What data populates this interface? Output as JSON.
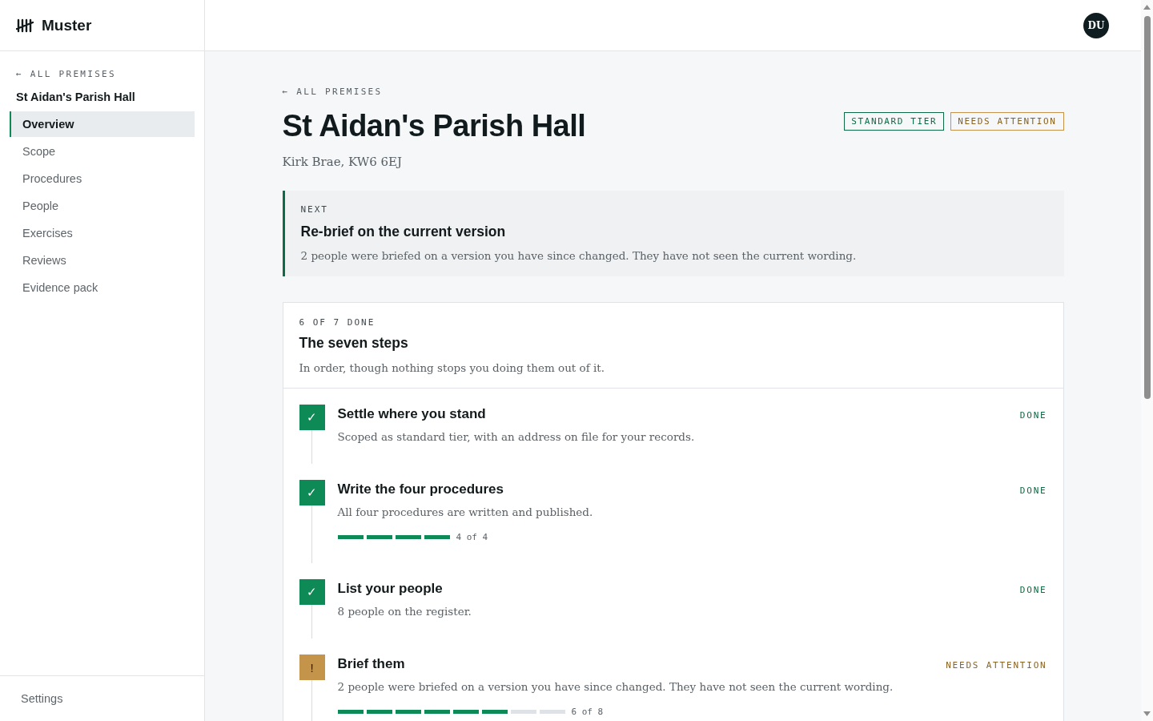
{
  "brand": {
    "name": "Muster"
  },
  "sidebar": {
    "back_link": "← ALL PREMISES",
    "premises": "St Aidan's Parish Hall",
    "items": [
      {
        "label": "Overview",
        "selected": true
      },
      {
        "label": "Scope",
        "selected": false
      },
      {
        "label": "Procedures",
        "selected": false
      },
      {
        "label": "People",
        "selected": false
      },
      {
        "label": "Exercises",
        "selected": false
      },
      {
        "label": "Reviews",
        "selected": false
      },
      {
        "label": "Evidence pack",
        "selected": false
      }
    ],
    "footer_item": "Settings"
  },
  "header": {
    "avatar": "DU"
  },
  "page": {
    "back_link": "← ALL PREMISES",
    "title": "St Aidan's Parish Hall",
    "address": "Kirk Brae, KW6 6EJ",
    "badges": [
      {
        "label": "STANDARD TIER",
        "kind": "tier"
      },
      {
        "label": "NEEDS ATTENTION",
        "kind": "attention"
      }
    ]
  },
  "next": {
    "eyebrow": "NEXT",
    "title": "Re-brief on the current version",
    "text": "2 people were briefed on a version you have since changed. They have not seen the current wording."
  },
  "steps": {
    "eyebrow": "6 OF 7 DONE",
    "title": "The seven steps",
    "subtitle": "In order, though nothing stops you doing them out of it.",
    "items": [
      {
        "kind": "done",
        "mark": "✓",
        "title": "Settle where you stand",
        "status": "DONE",
        "text": "Scoped as standard tier, with an address on file for your records."
      },
      {
        "kind": "done",
        "mark": "✓",
        "title": "Write the four procedures",
        "status": "DONE",
        "text": "All four procedures are written and published.",
        "progress": {
          "segments": [
            {
              "filled": true
            },
            {
              "filled": true
            },
            {
              "filled": true
            },
            {
              "filled": true
            }
          ],
          "reading": "4 of 4"
        }
      },
      {
        "kind": "done",
        "mark": "✓",
        "title": "List your people",
        "status": "DONE",
        "text": "8 people on the register."
      },
      {
        "kind": "attention",
        "mark": "!",
        "title": "Brief them",
        "status": "NEEDS ATTENTION",
        "text": "2 people were briefed on a version you have since changed. They have not seen the current wording.",
        "progress": {
          "segments": [
            {
              "filled": true
            },
            {
              "filled": true
            },
            {
              "filled": true
            },
            {
              "filled": true
            },
            {
              "filled": true
            },
            {
              "filled": true
            },
            {
              "filled": false
            },
            {
              "filled": false
            }
          ],
          "reading": "6 of 8"
        }
      }
    ]
  }
}
